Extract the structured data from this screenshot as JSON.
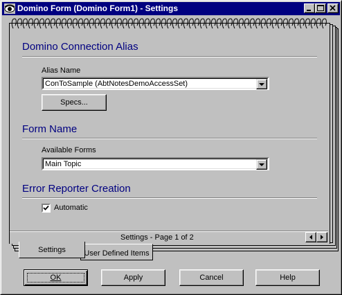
{
  "window": {
    "title": "Domino Form (Domino Form1) - Settings",
    "icon": "eye-icon",
    "controls": [
      "minimize-icon",
      "maximize-icon",
      "close-icon"
    ]
  },
  "sections": {
    "connection": {
      "title": "Domino Connection Alias",
      "alias_label": "Alias Name",
      "alias_value": "ConToSample (AbtNotesDemoAccessSet)",
      "specs_button": "Specs..."
    },
    "form": {
      "title": "Form Name",
      "forms_label": "Available Forms",
      "forms_value": "Main Topic"
    },
    "error": {
      "title": "Error Reporter Creation",
      "automatic_label": "Automatic",
      "automatic_checked": true
    }
  },
  "notebook": {
    "status": "Settings - Page 1 of 2",
    "tabs": [
      "Settings",
      "User Defined Items"
    ],
    "active_tab": 0
  },
  "buttons": {
    "ok": "OK",
    "apply": "Apply",
    "cancel": "Cancel",
    "help": "Help"
  },
  "colors": {
    "titlebar": "#000080",
    "section_title": "#000080",
    "face": "#c0c0c0"
  }
}
